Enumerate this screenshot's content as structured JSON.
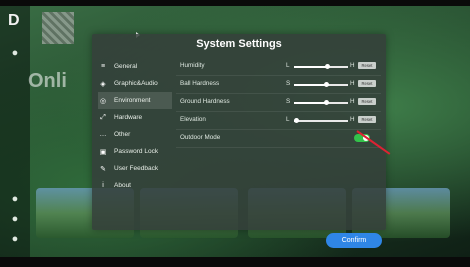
{
  "window": {
    "title": "System Settings"
  },
  "background": {
    "brand_text": "Onli"
  },
  "sidebar": {
    "items": [
      {
        "label": "General",
        "icon": "sliders-icon"
      },
      {
        "label": "Graphic&Audio",
        "icon": "palette-icon"
      },
      {
        "label": "Environment",
        "icon": "globe-icon"
      },
      {
        "label": "Hardware",
        "icon": "expand-icon"
      },
      {
        "label": "Other",
        "icon": "ellipsis-icon"
      },
      {
        "label": "Password Lock",
        "icon": "lock-icon"
      },
      {
        "label": "User Feedback",
        "icon": "feedback-icon"
      },
      {
        "label": "About",
        "icon": "info-icon"
      }
    ],
    "active_index": 2
  },
  "settings": {
    "humidity": {
      "label": "Humidity",
      "l": "L",
      "h": "H",
      "value_fraction": 0.62,
      "reset_label": "Reset"
    },
    "ball_hardness": {
      "label": "Ball Hardness",
      "l": "S",
      "h": "H",
      "value_fraction": 0.6,
      "reset_label": "Reset"
    },
    "ground_hardness": {
      "label": "Ground Hardness",
      "l": "S",
      "h": "H",
      "value_fraction": 0.6,
      "reset_label": "Reset"
    },
    "elevation": {
      "label": "Elevation",
      "l": "L",
      "h": "H",
      "value_fraction": 0.03,
      "reset_label": "Reset"
    },
    "outdoor_mode": {
      "label": "Outdoor Mode",
      "enabled": true
    }
  },
  "footer": {
    "confirm_label": "Confirm"
  },
  "colors": {
    "accent": "#2f86e6",
    "toggle_on": "#33c24a"
  }
}
